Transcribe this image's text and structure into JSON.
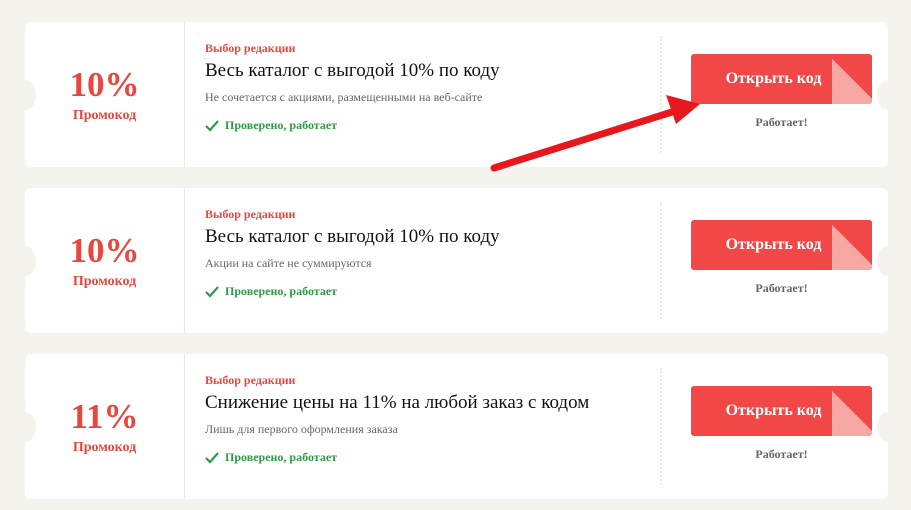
{
  "coupons": [
    {
      "discount": "10%",
      "type": "Промокод",
      "editor_choice": "Выбор редакции",
      "title": "Весь каталог с выгодой 10% по коду",
      "note": "Не сочетается с акциями, размещенными на веб-сайте",
      "verified": "Проверено, работает",
      "button_label": "Открыть код",
      "status": "Работает!"
    },
    {
      "discount": "10%",
      "type": "Промокод",
      "editor_choice": "Выбор редакции",
      "title": "Весь каталог с выгодой 10% по коду",
      "note": "Акции на сайте не суммируются",
      "verified": "Проверено, работает",
      "button_label": "Открыть код",
      "status": "Работает!"
    },
    {
      "discount": "11%",
      "type": "Промокод",
      "editor_choice": "Выбор редакции",
      "title": "Снижение цены на 11% на любой заказ с кодом",
      "note": "Лишь для первого оформления заказа",
      "verified": "Проверено, работает",
      "button_label": "Открыть код",
      "status": "Работает!"
    }
  ],
  "colors": {
    "accent": "#f24747",
    "verified": "#2f9a46",
    "background": "#f5f3ee",
    "annotation_arrow": "#e8161d"
  },
  "icons": {
    "verified": "check-icon",
    "annotation": "red-arrow-pointer"
  }
}
